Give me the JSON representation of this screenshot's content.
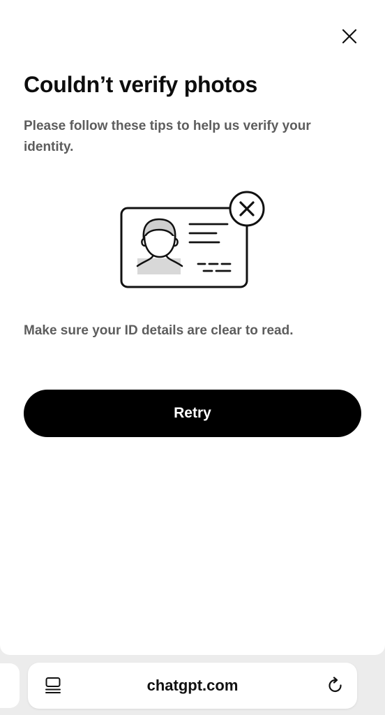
{
  "dialog": {
    "title": "Couldn’t verify photos",
    "subtitle": "Please follow these tips to help us verify your identity.",
    "tip": "Make sure your ID details are clear to read.",
    "retry_label": "Retry"
  },
  "browser": {
    "url": "chatgpt.com"
  },
  "icons": {
    "close": "close-icon",
    "id_card": "id-card-error-illustration",
    "tabs": "tab-overview-icon",
    "reload": "reload-icon"
  },
  "colors": {
    "button_bg": "#000000",
    "button_text": "#ffffff",
    "title_text": "#0d0d0d",
    "body_text": "#5d5d5d",
    "browser_chrome": "#ececec"
  }
}
